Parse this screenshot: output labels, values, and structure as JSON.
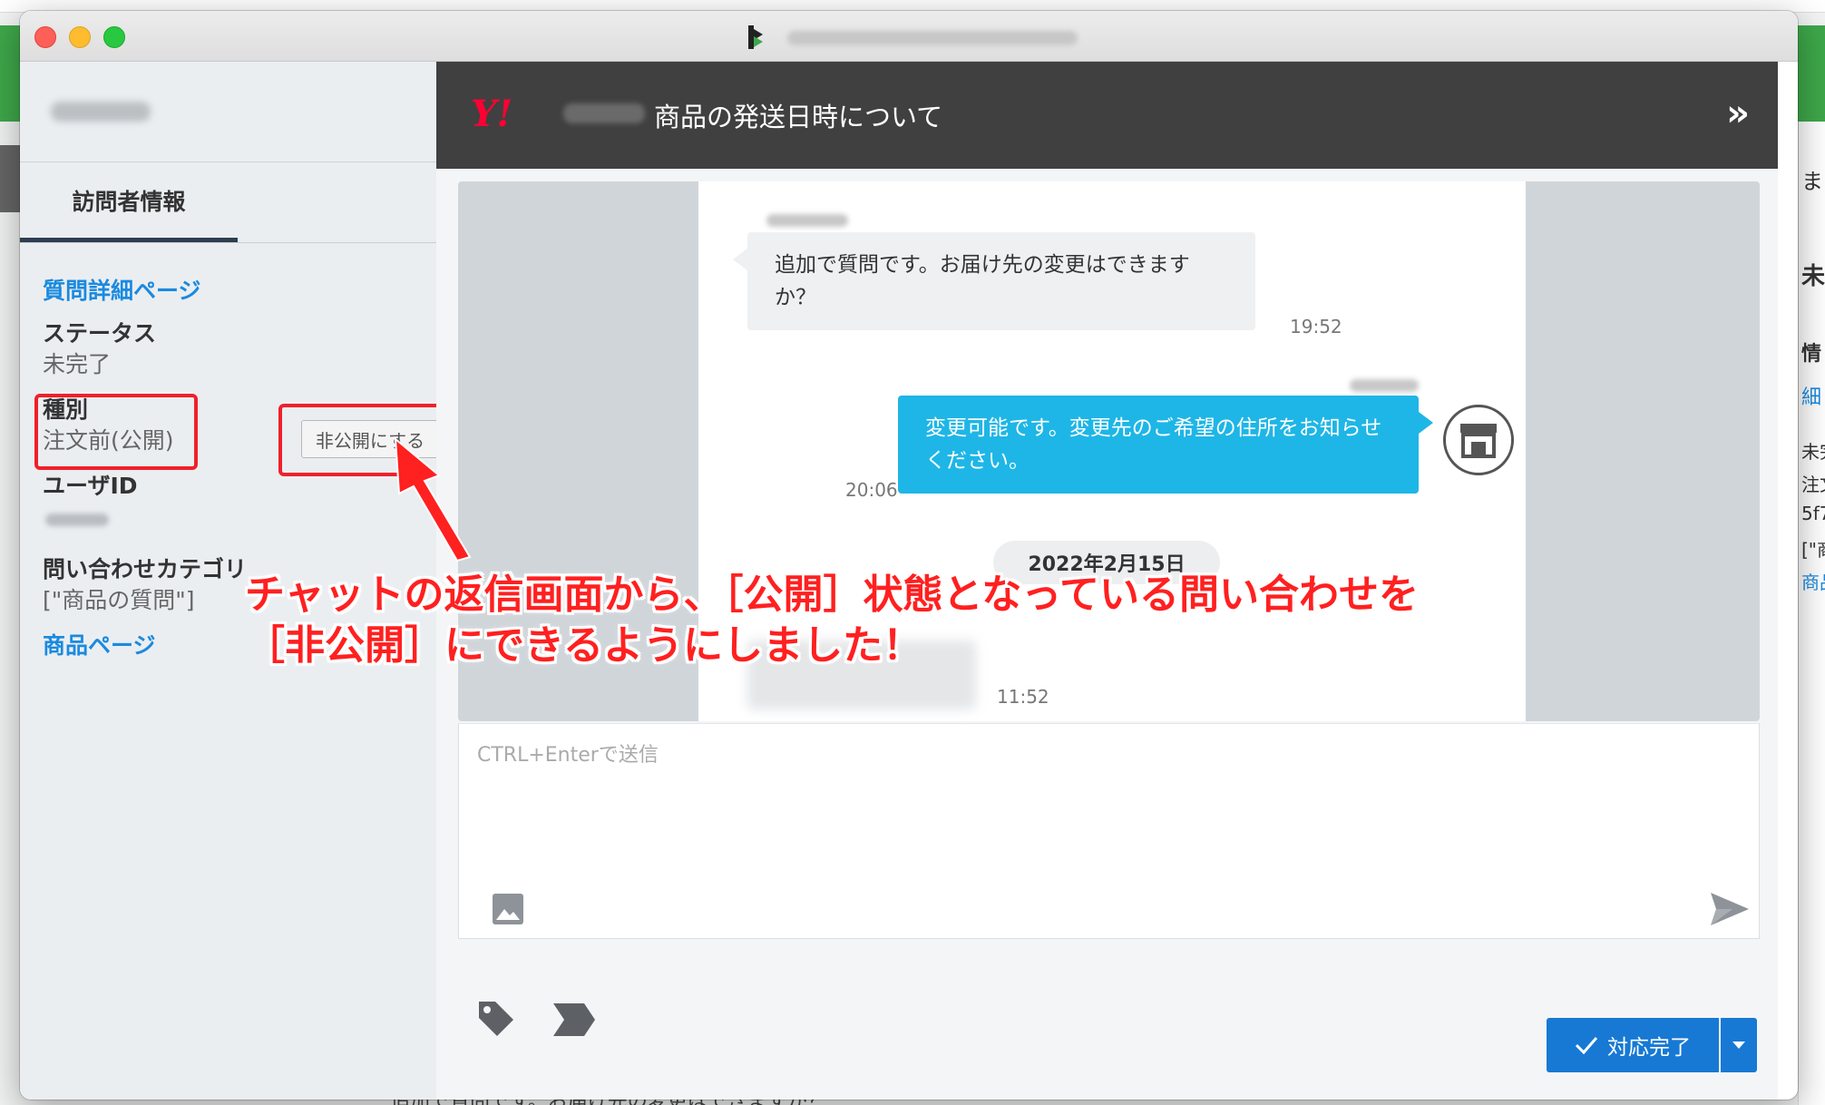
{
  "window": {
    "title_blurred": true
  },
  "sidebar": {
    "tab_visitor": "訪問者情報",
    "question_detail_link": "質問詳細ページ",
    "status_label": "ステータス",
    "status_value": "未完了",
    "type_label": "種別",
    "type_value": "注文前(公開)",
    "unpublish_button": "非公開にする",
    "user_id_label": "ユーザID",
    "category_label": "問い合わせカテゴリ",
    "category_value": "[\"商品の質問\"]",
    "product_page_link": "商品ページ"
  },
  "chat": {
    "header_title": "商品の発送日時について",
    "collapse_label": "»",
    "messages": [
      {
        "direction": "incoming",
        "text": "追加で質問です。お届け先の変更はできますか？",
        "time": "19:52"
      },
      {
        "direction": "outgoing",
        "text": "変更可能です。変更先のご希望の住所をお知らせください。",
        "time": "20:06"
      },
      {
        "direction": "incoming",
        "text_blurred": true,
        "time": "11:52"
      }
    ],
    "date_divider": "2022年2月15日",
    "input_placeholder": "CTRL+Enterで送信",
    "complete_button": "対応完了"
  },
  "annotation": {
    "line1": "チャットの返信画面から、［公開］状態となっている問い合わせを",
    "line2": "［非公開］にできるようにしました！"
  },
  "background": {
    "right_chars": [
      "ま",
      "未",
      "情",
      "細",
      "未完",
      "注文",
      "5f7",
      "[\"商",
      "商品"
    ],
    "bottom_text": "追加で質問です。お届け先の変更はできますか？"
  },
  "icons": {
    "shop": "store-icon",
    "image": "image-icon",
    "send": "send-icon",
    "tag": "tag-icon",
    "label": "label-icon",
    "check": "check-icon",
    "caret": "caret-down-icon"
  },
  "colors": {
    "header_bg": "#404040",
    "outgoing_bubble": "#1eb6e6",
    "link_blue": "#1a8ae0",
    "primary_button": "#1779d4",
    "annotation_red": "#ff2020"
  }
}
